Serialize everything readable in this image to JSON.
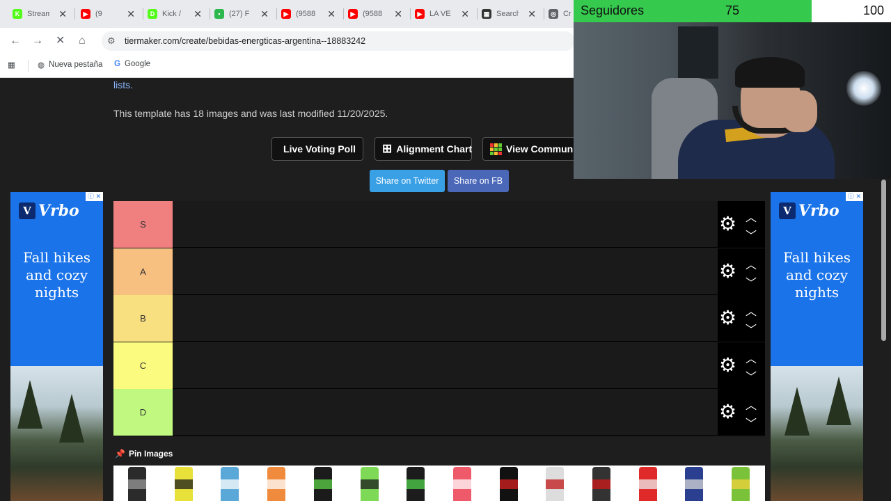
{
  "tabs": [
    {
      "title": "Stream",
      "icon": "kick-icon",
      "color": "#53fc18",
      "glyph": "K"
    },
    {
      "title": "(9",
      "icon": "youtube-icon",
      "color": "#ff0000",
      "glyph": "▶"
    },
    {
      "title": "Kick /",
      "icon": "kick-icon",
      "color": "#53fc18",
      "glyph": "D"
    },
    {
      "title": "(27) F",
      "icon": "app-icon",
      "color": "#2db84d",
      "glyph": "•"
    },
    {
      "title": "(9588",
      "icon": "youtube-icon",
      "color": "#ff0000",
      "glyph": "▶"
    },
    {
      "title": "(9588",
      "icon": "youtube-icon",
      "color": "#ff0000",
      "glyph": "▶"
    },
    {
      "title": "LA VE",
      "icon": "youtube-icon",
      "color": "#ff0000",
      "glyph": "▶"
    },
    {
      "title": "Search",
      "icon": "grid-icon",
      "color": "#333333",
      "glyph": "▦"
    },
    {
      "title": "Cr",
      "icon": "tiermaker-icon",
      "color": "#5f6368",
      "glyph": "◎"
    }
  ],
  "address": {
    "url": "tiermaker.com/create/bebidas-energticas-argentina--18883242"
  },
  "bookmarks": {
    "new_tab": "Nueva pestaña",
    "google": "Google"
  },
  "page": {
    "link_fragment": "lists.",
    "template_info": "This template has 18 images and was last modified 11/20/2025.",
    "live_voting": "Live Voting Poll",
    "alignment_chart": "Alignment Chart",
    "view_community": "View Community",
    "share_twitter": "Share on Twitter",
    "share_fb": "Share on FB",
    "pin_images": "Pin Images"
  },
  "ads": {
    "brand": "Vrbo",
    "headline_1": "Fall hikes",
    "headline_2": "and cozy",
    "headline_3": "nights",
    "ad_mark": "ⓘ ✕"
  },
  "tiers": [
    {
      "label": "S",
      "color": "#f07f7f"
    },
    {
      "label": "A",
      "color": "#f7bf80"
    },
    {
      "label": "B",
      "color": "#f8df80"
    },
    {
      "label": "C",
      "color": "#fbfb80"
    },
    {
      "label": "D",
      "color": "#c0f880"
    }
  ],
  "cans": [
    {
      "color": "#2b2b2b",
      "band": "#9a9a9a"
    },
    {
      "color": "#e8e13a",
      "band": "#1c1c1c"
    },
    {
      "color": "#5aa8d8",
      "band": "#ffffff"
    },
    {
      "color": "#f08a3c",
      "band": "#ffffff"
    },
    {
      "color": "#1b1b1b",
      "band": "#5ed34a"
    },
    {
      "color": "#7ed957",
      "band": "#1b1b1b"
    },
    {
      "color": "#1c1c1c",
      "band": "#4fd14a"
    },
    {
      "color": "#ef5a6a",
      "band": "#ffffff"
    },
    {
      "color": "#111111",
      "band": "#d62020"
    },
    {
      "color": "#dddddd",
      "band": "#c21818"
    },
    {
      "color": "#333333",
      "band": "#d11a1a"
    },
    {
      "color": "#e02a2a",
      "band": "#eeeeee"
    },
    {
      "color": "#2a3f8f",
      "band": "#d8d8d8"
    },
    {
      "color": "#7ac23a",
      "band": "#f2d23a"
    }
  ],
  "overlay": {
    "label": "Seguidores",
    "current": "75",
    "goal": "100",
    "progress": 0.75,
    "bar_color": "#35c94d"
  }
}
